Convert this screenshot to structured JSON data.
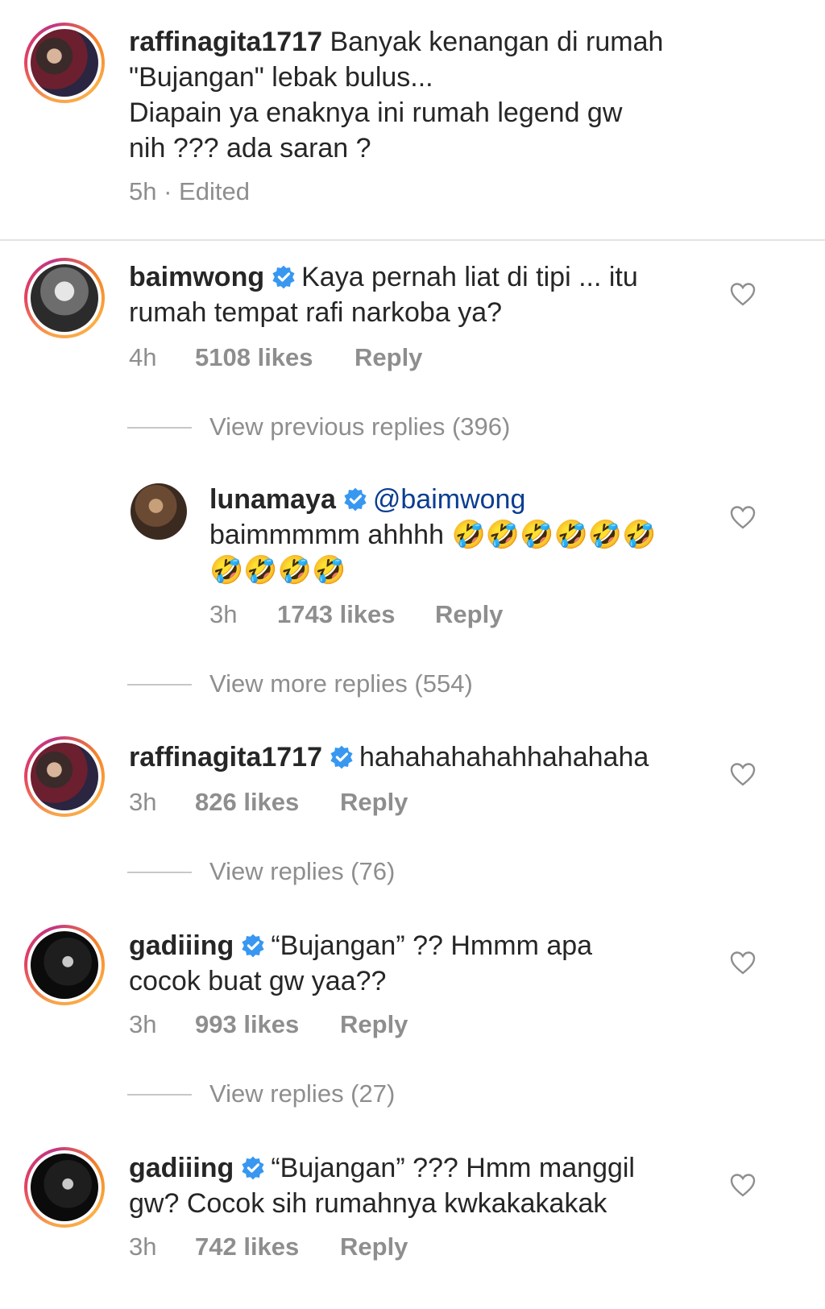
{
  "caption": {
    "username": "raffinagita1717",
    "line1": "Banyak kenangan di rumah",
    "line2": "\"Bujangan\" lebak bulus...",
    "line3": "Diapain ya enaknya ini rumah legend gw",
    "line4": "nih ??? ada saran ?",
    "meta": "5h · Edited"
  },
  "comments": [
    {
      "username": "baimwong",
      "text_line1": "Kaya pernah liat di tipi ... itu",
      "text_line2": "rumah tempat rafi narkoba ya?",
      "time": "4h",
      "likes": "5108 likes",
      "reply": "Reply",
      "view_label": "View previous replies (396)"
    },
    {
      "username": "lunamaya",
      "mention": "@baimwong",
      "text_line1": "baimmmmm  ahhhh",
      "emoji_line1": "🤣🤣🤣🤣🤣🤣",
      "emoji_line2": "🤣🤣🤣🤣",
      "time": "3h",
      "likes": "1743 likes",
      "reply": "Reply",
      "view_label": "View more replies (554)"
    },
    {
      "username": "raffinagita1717",
      "text_line1": "hahahahahahhahahaha",
      "time": "3h",
      "likes": "826 likes",
      "reply": "Reply",
      "view_label": "View replies (76)"
    },
    {
      "username": "gadiiing",
      "text_line1": "“Bujangan” ?? Hmmm apa",
      "text_line2": "cocok buat gw yaa??",
      "time": "3h",
      "likes": "993 likes",
      "reply": "Reply",
      "view_label": "View replies (27)"
    },
    {
      "username": "gadiiing",
      "text_line1": "“Bujangan” ??? Hmm manggil",
      "text_line2": "gw? Cocok sih rumahnya kwkakakakak",
      "time": "3h",
      "likes": "742 likes",
      "reply": "Reply"
    }
  ],
  "icons": {
    "verified": "verified-badge-icon",
    "like": "heart-outline-icon"
  },
  "colors": {
    "verified_blue": "#3897f0",
    "meta_gray": "#8e8e8e"
  }
}
